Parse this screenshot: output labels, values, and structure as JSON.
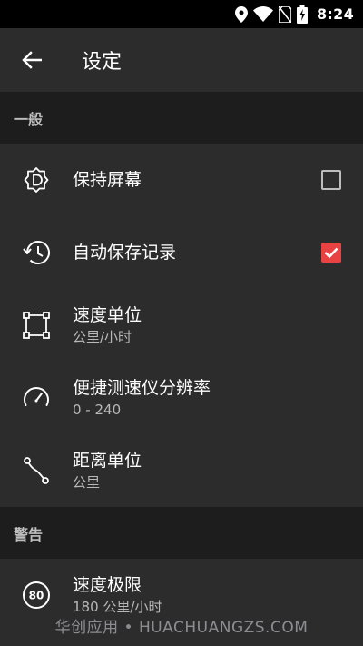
{
  "status_bar": {
    "time": "8:24",
    "icons": [
      "location-icon",
      "wifi-icon",
      "no-sim-icon",
      "battery-charging-icon"
    ]
  },
  "app_bar": {
    "back_icon": "arrow-left-icon",
    "title": "设定"
  },
  "sections": {
    "general": {
      "header": "一般",
      "items": [
        {
          "icon": "screen-on-icon",
          "title": "保持屏幕",
          "checkbox": false
        },
        {
          "icon": "history-icon",
          "title": "自动保存记录",
          "checkbox": true
        },
        {
          "icon": "vector-square-icon",
          "title": "速度单位",
          "subtitle": "公里/小时"
        },
        {
          "icon": "speedometer-icon",
          "title": "便捷测速仪分辨率",
          "subtitle": "0 - 240"
        },
        {
          "icon": "route-icon",
          "title": "距离单位",
          "subtitle": "公里"
        }
      ]
    },
    "warning": {
      "header": "警告",
      "items": [
        {
          "icon": "speed-limit-80-icon",
          "icon_text": "80",
          "title": "速度极限",
          "subtitle": "180 公里/小时"
        }
      ]
    }
  },
  "watermark": "华创应用 • HUACHUANGZS.COM",
  "colors": {
    "background": "#2c2c2c",
    "section_header_bg": "#1d1d1d",
    "accent": "#e84242",
    "status_bar_bg": "#000000"
  }
}
